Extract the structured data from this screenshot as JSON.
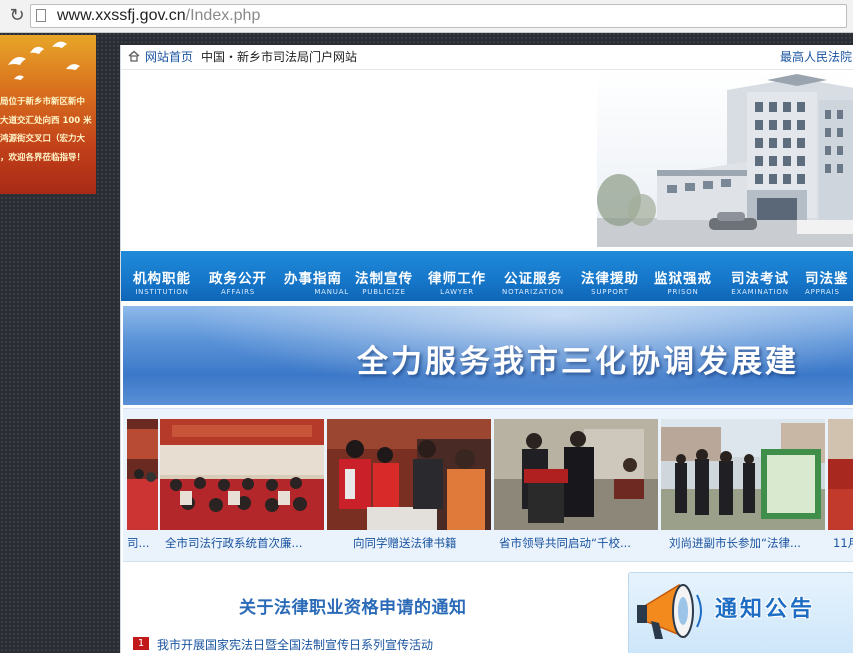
{
  "browser": {
    "url_host": "www.xxssfj.gov.cn",
    "url_path": "/Index.php"
  },
  "float_ad": {
    "lines": [
      "局位于新乡市新区新中",
      "大道交汇处向西 100 米",
      "鸿源街交叉口（宏力大",
      "，欢迎各界莅临指导！"
    ]
  },
  "topbar": {
    "home_link": "网站首页",
    "site_name": "中国・新乡市司法局门户网站",
    "court_link": "最高人民法院"
  },
  "nav": {
    "items": [
      {
        "zh": "机构职能",
        "en": "INSTITUTION"
      },
      {
        "zh": "政务公开",
        "en": "AFFAIRS"
      },
      {
        "zh": "办事指南",
        "en": "MANUAL"
      },
      {
        "zh": "法制宣传",
        "en": "PUBLICIZE"
      },
      {
        "zh": "律师工作",
        "en": "LAWYER"
      },
      {
        "zh": "公证服务",
        "en": "NOTARIZATION"
      },
      {
        "zh": "法律援助",
        "en": "SUPPORT"
      },
      {
        "zh": "监狱强戒",
        "en": "PRISON"
      },
      {
        "zh": "司法考试",
        "en": "EXAMINATION"
      },
      {
        "zh": "司法鉴",
        "en": "APPRAIS"
      }
    ]
  },
  "slogan": {
    "text": "全力服务我市三化协调发展建"
  },
  "photo_strip": {
    "captions": [
      "司...",
      "全市司法行政系统首次廉...",
      "向同学赠送法律书籍",
      "省市领导共同启动“千校...",
      "刘尚进副市长参加“法律...",
      "11月"
    ]
  },
  "content": {
    "notice_title": "关于法律职业资格申请的通知",
    "news": [
      {
        "num": "1",
        "text": "我市开展国家宪法日暨全国法制宣传日系列宣传活动"
      }
    ],
    "notice_box_label": "通知公告"
  },
  "colors": {
    "nav_blue": "#1676c9",
    "link_blue": "#1a54a0",
    "title_blue": "#2a6ab7",
    "badge_red": "#c21a1a"
  }
}
